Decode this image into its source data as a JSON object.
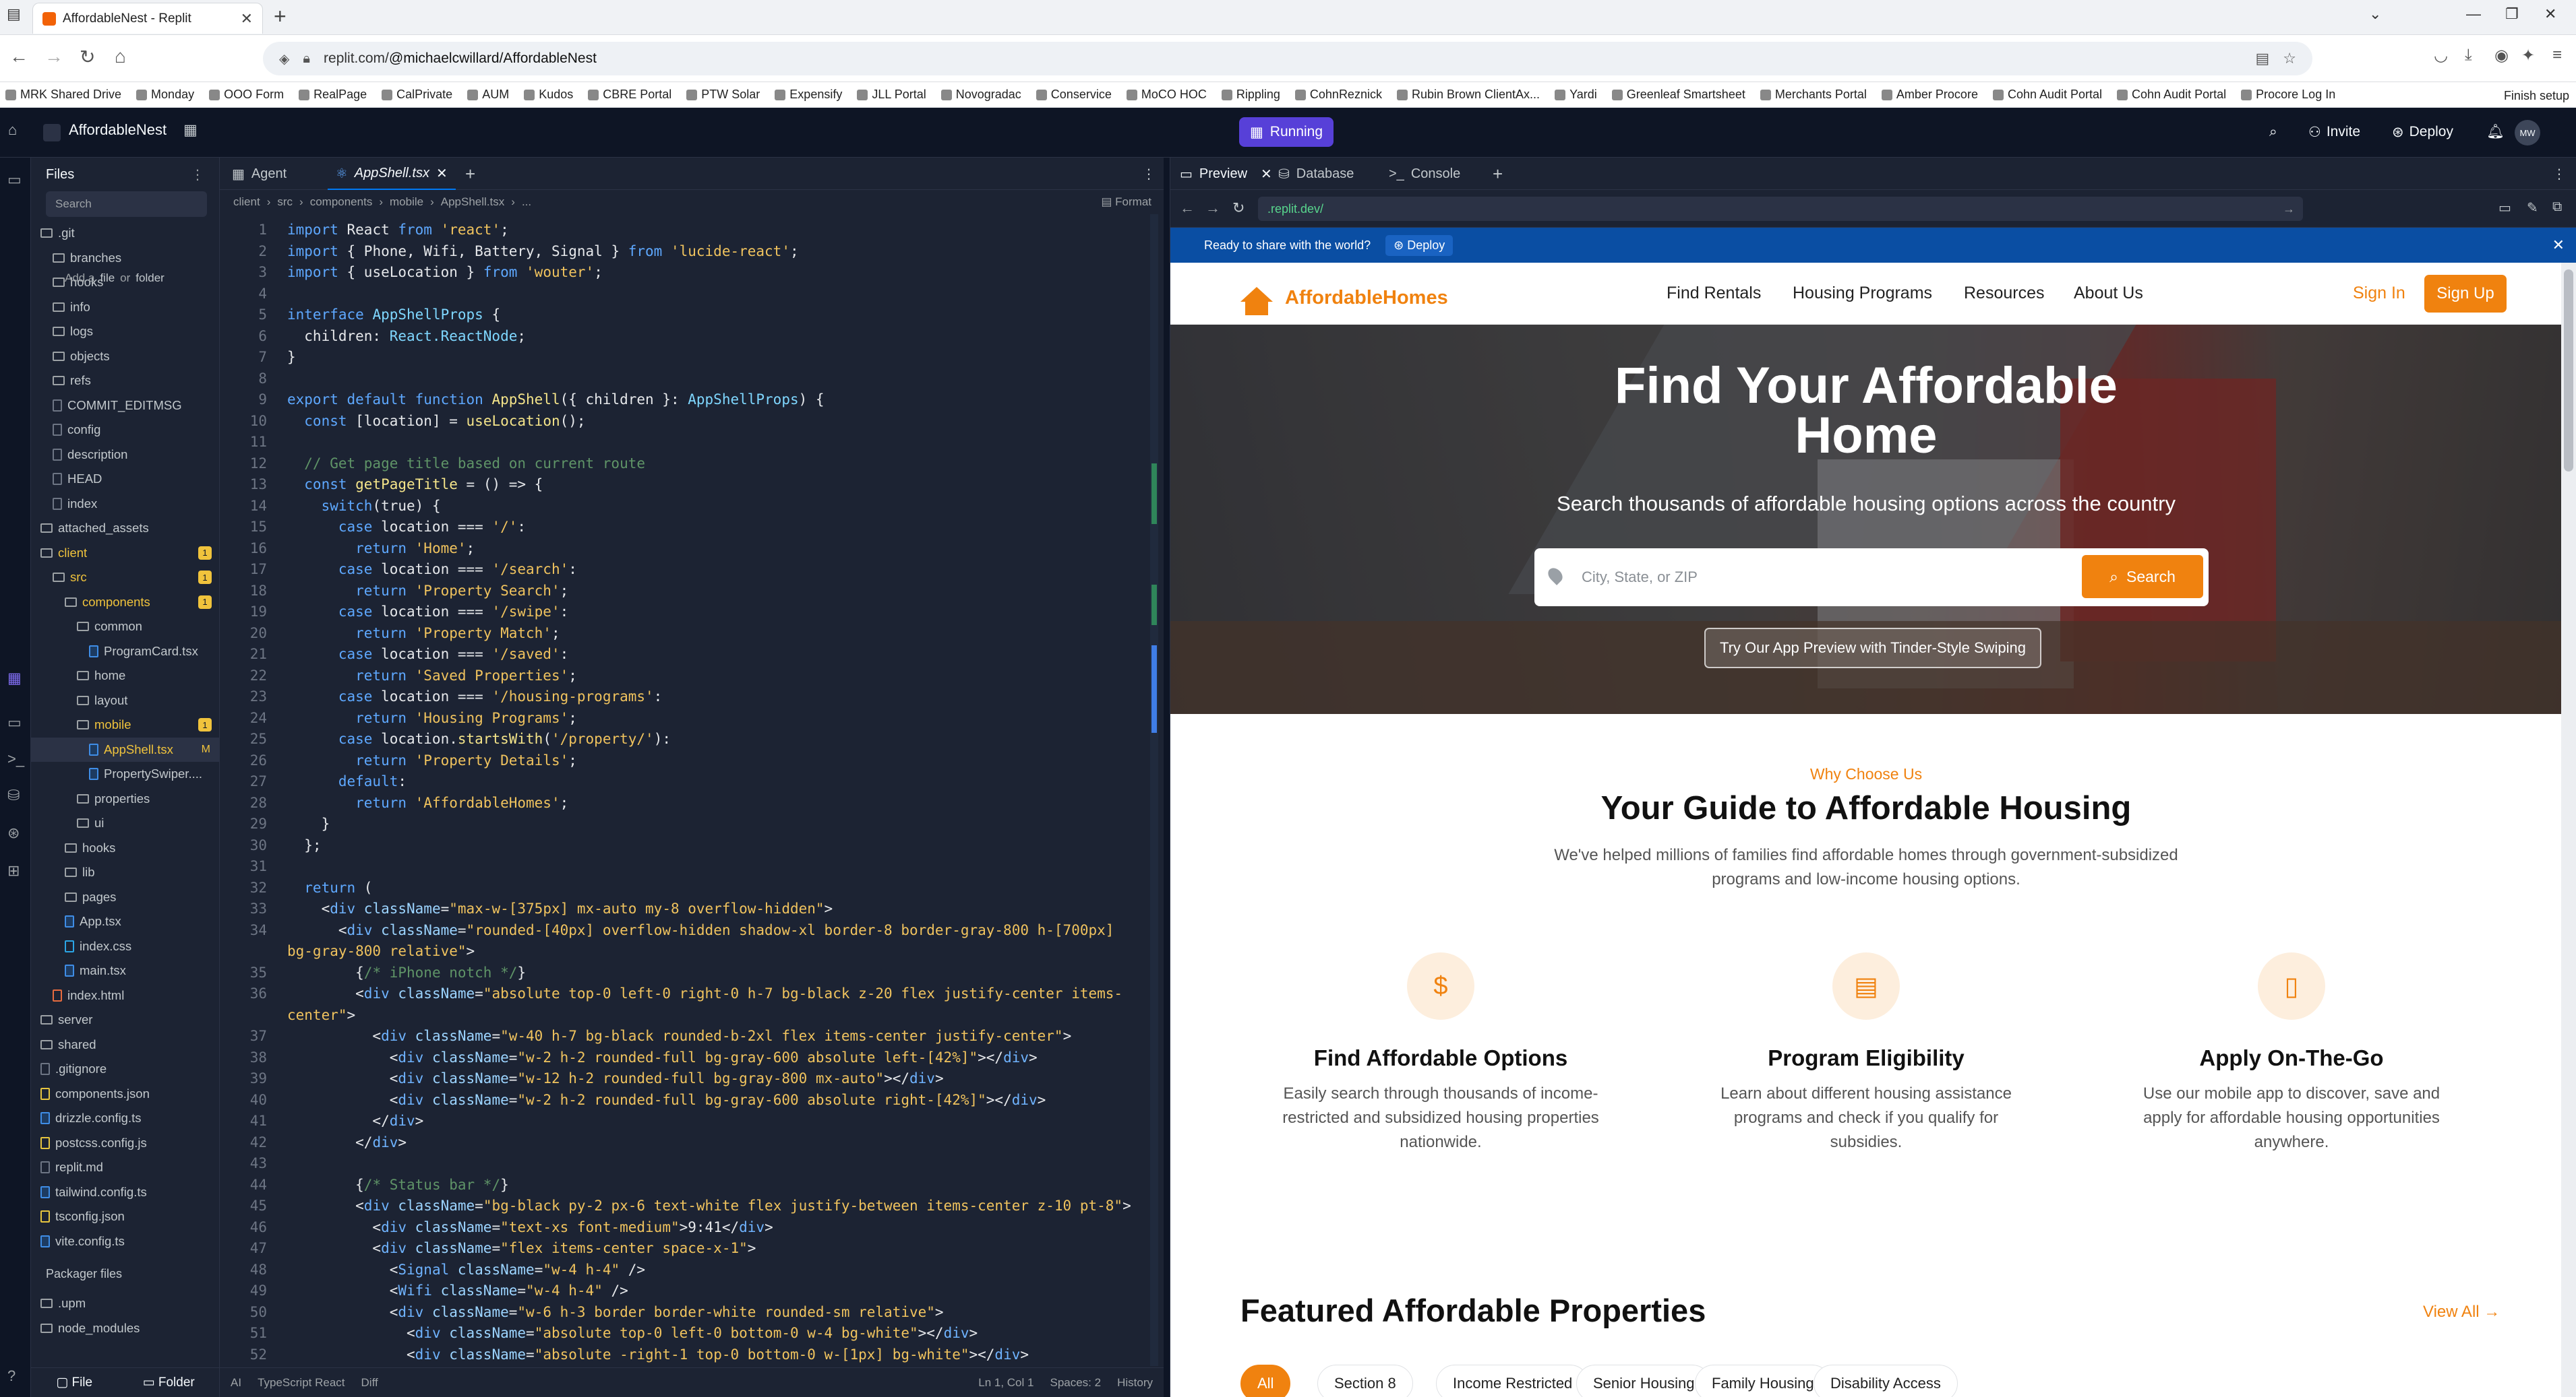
{
  "browser": {
    "tab_title": "AffordableNest - Replit",
    "url_prefix": "replit.com/",
    "url_path": "@michaelcwillard/AffordableNest",
    "bookmarks": [
      "MRK Shared Drive",
      "Monday",
      "OOO Form",
      "RealPage",
      "CalPrivate",
      "AUM",
      "Kudos",
      "CBRE Portal",
      "PTW Solar",
      "Expensify",
      "JLL Portal",
      "Novogradac",
      "Conservice",
      "MoCO HOC",
      "Rippling",
      "CohnReznick",
      "Rubin Brown ClientAx...",
      "Yardi",
      "Greenleaf Smartsheet",
      "Merchants Portal",
      "Amber Procore",
      "Cohn Audit Portal",
      "Cohn Audit Portal",
      "Procore Log In"
    ],
    "finish_setup": "Finish setup"
  },
  "replit": {
    "project": "AffordableNest",
    "run_label": "Running",
    "invite": "Invite",
    "deploy": "Deploy",
    "avatar": "MW"
  },
  "files": {
    "title": "Files",
    "search_placeholder": "Search",
    "add_hint": [
      "Add a",
      "file",
      "or",
      "folder"
    ],
    "rows": [
      {
        "label": ".git",
        "depth": 0,
        "kind": "dir"
      },
      {
        "label": "branches",
        "depth": 1,
        "kind": "dir"
      },
      {
        "label": "hooks",
        "depth": 1,
        "kind": "dir"
      },
      {
        "label": "info",
        "depth": 1,
        "kind": "dir"
      },
      {
        "label": "logs",
        "depth": 1,
        "kind": "dir"
      },
      {
        "label": "objects",
        "depth": 1,
        "kind": "dir"
      },
      {
        "label": "refs",
        "depth": 1,
        "kind": "dir"
      },
      {
        "label": "COMMIT_EDITMSG",
        "depth": 1,
        "kind": "file"
      },
      {
        "label": "config",
        "depth": 1,
        "kind": "file"
      },
      {
        "label": "description",
        "depth": 1,
        "kind": "file"
      },
      {
        "label": "HEAD",
        "depth": 1,
        "kind": "file"
      },
      {
        "label": "index",
        "depth": 1,
        "kind": "file"
      },
      {
        "label": "attached_assets",
        "depth": 0,
        "kind": "dir"
      },
      {
        "label": "client",
        "depth": 0,
        "kind": "dir",
        "badge": "1",
        "mod": true
      },
      {
        "label": "src",
        "depth": 1,
        "kind": "dir",
        "badge": "1",
        "mod": true
      },
      {
        "label": "components",
        "depth": 2,
        "kind": "dir",
        "badge": "1",
        "mod": true
      },
      {
        "label": "common",
        "depth": 3,
        "kind": "dir"
      },
      {
        "label": "ProgramCard.tsx",
        "depth": 4,
        "kind": "ts"
      },
      {
        "label": "home",
        "depth": 3,
        "kind": "dir"
      },
      {
        "label": "layout",
        "depth": 3,
        "kind": "dir"
      },
      {
        "label": "mobile",
        "depth": 3,
        "kind": "dir",
        "badge": "1",
        "mod": true
      },
      {
        "label": "AppShell.tsx",
        "depth": 4,
        "kind": "ts",
        "sel": true,
        "mod": true,
        "flag": "M"
      },
      {
        "label": "PropertySwiper....",
        "depth": 4,
        "kind": "ts"
      },
      {
        "label": "properties",
        "depth": 3,
        "kind": "dir"
      },
      {
        "label": "ui",
        "depth": 3,
        "kind": "dir"
      },
      {
        "label": "hooks",
        "depth": 2,
        "kind": "dir"
      },
      {
        "label": "lib",
        "depth": 2,
        "kind": "dir"
      },
      {
        "label": "pages",
        "depth": 2,
        "kind": "dir"
      },
      {
        "label": "App.tsx",
        "depth": 2,
        "kind": "ts"
      },
      {
        "label": "index.css",
        "depth": 2,
        "kind": "cs"
      },
      {
        "label": "main.tsx",
        "depth": 2,
        "kind": "ts"
      },
      {
        "label": "index.html",
        "depth": 1,
        "kind": "h"
      },
      {
        "label": "server",
        "depth": 0,
        "kind": "dir"
      },
      {
        "label": "shared",
        "depth": 0,
        "kind": "dir"
      },
      {
        "label": ".gitignore",
        "depth": 0,
        "kind": "file"
      },
      {
        "label": "components.json",
        "depth": 0,
        "kind": "js"
      },
      {
        "label": "drizzle.config.ts",
        "depth": 0,
        "kind": "ts"
      },
      {
        "label": "postcss.config.js",
        "depth": 0,
        "kind": "js"
      },
      {
        "label": "replit.md",
        "depth": 0,
        "kind": "file"
      },
      {
        "label": "tailwind.config.ts",
        "depth": 0,
        "kind": "ts"
      },
      {
        "label": "tsconfig.json",
        "depth": 0,
        "kind": "js"
      },
      {
        "label": "vite.config.ts",
        "depth": 0,
        "kind": "ts"
      }
    ],
    "packager_title": "Packager files",
    "packager_rows": [
      ".upm",
      "node_modules"
    ],
    "new_file": "File",
    "new_folder": "Folder"
  },
  "editor": {
    "tab_agent": "Agent",
    "tab_file": "AppShell.tsx",
    "breadcrumb": [
      "client",
      "src",
      "components",
      "mobile",
      "AppShell.tsx",
      "..."
    ],
    "format": "Format",
    "status": {
      "ai": "AI",
      "lang": "TypeScript React",
      "diff": "Diff",
      "pos": "Ln 1, Col 1",
      "spaces": "Spaces: 2",
      "history": "History"
    }
  },
  "code_lines": [
    [
      [
        "k",
        "import "
      ],
      [
        "p",
        "React "
      ],
      [
        "k",
        "from "
      ],
      [
        "s",
        "'react'"
      ],
      [
        "p",
        ";"
      ]
    ],
    [
      [
        "k",
        "import "
      ],
      [
        "p",
        "{ Phone, Wifi, Battery, Signal } "
      ],
      [
        "k",
        "from "
      ],
      [
        "s",
        "'lucide-react'"
      ],
      [
        "p",
        ";"
      ]
    ],
    [
      [
        "k",
        "import "
      ],
      [
        "p",
        "{ useLocation } "
      ],
      [
        "k",
        "from "
      ],
      [
        "s",
        "'wouter'"
      ],
      [
        "p",
        ";"
      ]
    ],
    [],
    [
      [
        "k",
        "interface "
      ],
      [
        "t",
        "AppShellProps "
      ],
      [
        "p",
        "{"
      ]
    ],
    [
      [
        "p",
        "  children: "
      ],
      [
        "t",
        "React.ReactNode"
      ],
      [
        "p",
        ";"
      ]
    ],
    [
      [
        "p",
        "}"
      ]
    ],
    [],
    [
      [
        "k",
        "export default function "
      ],
      [
        "fn",
        "AppShell"
      ],
      [
        "p",
        "({ children }: "
      ],
      [
        "t",
        "AppShellProps"
      ],
      [
        "p",
        ") {"
      ]
    ],
    [
      [
        "k",
        "  const "
      ],
      [
        "p",
        "[location] = "
      ],
      [
        "fn",
        "useLocation"
      ],
      [
        "p",
        "();"
      ]
    ],
    [],
    [
      [
        "c",
        "  // Get page title based on current route"
      ]
    ],
    [
      [
        "k",
        "  const "
      ],
      [
        "fn",
        "getPageTitle "
      ],
      [
        "p",
        "= () => {"
      ]
    ],
    [
      [
        "k",
        "    switch"
      ],
      [
        "p",
        "(true) {"
      ]
    ],
    [
      [
        "k",
        "      case "
      ],
      [
        "p",
        "location === "
      ],
      [
        "s",
        "'/'"
      ],
      [
        "p",
        ":"
      ]
    ],
    [
      [
        "k",
        "        return "
      ],
      [
        "s",
        "'Home'"
      ],
      [
        "p",
        ";"
      ]
    ],
    [
      [
        "k",
        "      case "
      ],
      [
        "p",
        "location === "
      ],
      [
        "s",
        "'/search'"
      ],
      [
        "p",
        ":"
      ]
    ],
    [
      [
        "k",
        "        return "
      ],
      [
        "s",
        "'Property Search'"
      ],
      [
        "p",
        ";"
      ]
    ],
    [
      [
        "k",
        "      case "
      ],
      [
        "p",
        "location === "
      ],
      [
        "s",
        "'/swipe'"
      ],
      [
        "p",
        ":"
      ]
    ],
    [
      [
        "k",
        "        return "
      ],
      [
        "s",
        "'Property Match'"
      ],
      [
        "p",
        ";"
      ]
    ],
    [
      [
        "k",
        "      case "
      ],
      [
        "p",
        "location === "
      ],
      [
        "s",
        "'/saved'"
      ],
      [
        "p",
        ":"
      ]
    ],
    [
      [
        "k",
        "        return "
      ],
      [
        "s",
        "'Saved Properties'"
      ],
      [
        "p",
        ";"
      ]
    ],
    [
      [
        "k",
        "      case "
      ],
      [
        "p",
        "location === "
      ],
      [
        "s",
        "'/housing-programs'"
      ],
      [
        "p",
        ":"
      ]
    ],
    [
      [
        "k",
        "        return "
      ],
      [
        "s",
        "'Housing Programs'"
      ],
      [
        "p",
        ";"
      ]
    ],
    [
      [
        "k",
        "      case "
      ],
      [
        "p",
        "location."
      ],
      [
        "fn",
        "startsWith"
      ],
      [
        "p",
        "("
      ],
      [
        "s",
        "'/property/'"
      ],
      [
        "p",
        "):"
      ]
    ],
    [
      [
        "k",
        "        return "
      ],
      [
        "s",
        "'Property Details'"
      ],
      [
        "p",
        ";"
      ]
    ],
    [
      [
        "k",
        "      default"
      ],
      [
        "p",
        ":"
      ]
    ],
    [
      [
        "k",
        "        return "
      ],
      [
        "s",
        "'AffordableHomes'"
      ],
      [
        "p",
        ";"
      ]
    ],
    [
      [
        "p",
        "    }"
      ]
    ],
    [
      [
        "p",
        "  };"
      ]
    ],
    [],
    [
      [
        "k",
        "  return "
      ],
      [
        "p",
        "("
      ]
    ],
    [
      [
        "p",
        "    <"
      ],
      [
        "tg",
        "div "
      ],
      [
        "at",
        "className"
      ],
      [
        "p",
        "="
      ],
      [
        "s",
        "\"max-w-[375px] mx-auto my-8 overflow-hidden\""
      ],
      [
        "p",
        ">"
      ]
    ],
    [
      [
        "p",
        "      <"
      ],
      [
        "tg",
        "div "
      ],
      [
        "at",
        "className"
      ],
      [
        "p",
        "="
      ],
      [
        "s",
        "\"rounded-[40px] overflow-hidden shadow-xl border-8 border-gray-800 h-[700px]"
      ]
    ],
    [
      [
        "s",
        "bg-gray-800 relative\""
      ],
      [
        "p",
        ">"
      ]
    ],
    [
      [
        "p",
        "        {"
      ],
      [
        "c",
        "/* iPhone notch */"
      ],
      [
        "p",
        "}"
      ]
    ],
    [
      [
        "p",
        "        <"
      ],
      [
        "tg",
        "div "
      ],
      [
        "at",
        "className"
      ],
      [
        "p",
        "="
      ],
      [
        "s",
        "\"absolute top-0 left-0 right-0 h-7 bg-black z-20 flex justify-center items-"
      ]
    ],
    [
      [
        "s",
        "center\""
      ],
      [
        "p",
        ">"
      ]
    ],
    [
      [
        "p",
        "          <"
      ],
      [
        "tg",
        "div "
      ],
      [
        "at",
        "className"
      ],
      [
        "p",
        "="
      ],
      [
        "s",
        "\"w-40 h-7 bg-black rounded-b-2xl flex items-center justify-center\""
      ],
      [
        "p",
        ">"
      ]
    ],
    [
      [
        "p",
        "            <"
      ],
      [
        "tg",
        "div "
      ],
      [
        "at",
        "className"
      ],
      [
        "p",
        "="
      ],
      [
        "s",
        "\"w-2 h-2 rounded-full bg-gray-600 absolute left-[42%]\""
      ],
      [
        "p",
        "></"
      ],
      [
        "tg",
        "div"
      ],
      [
        "p",
        ">"
      ]
    ],
    [
      [
        "p",
        "            <"
      ],
      [
        "tg",
        "div "
      ],
      [
        "at",
        "className"
      ],
      [
        "p",
        "="
      ],
      [
        "s",
        "\"w-12 h-2 rounded-full bg-gray-800 mx-auto\""
      ],
      [
        "p",
        "></"
      ],
      [
        "tg",
        "div"
      ],
      [
        "p",
        ">"
      ]
    ],
    [
      [
        "p",
        "            <"
      ],
      [
        "tg",
        "div "
      ],
      [
        "at",
        "className"
      ],
      [
        "p",
        "="
      ],
      [
        "s",
        "\"w-2 h-2 rounded-full bg-gray-600 absolute right-[42%]\""
      ],
      [
        "p",
        "></"
      ],
      [
        "tg",
        "div"
      ],
      [
        "p",
        ">"
      ]
    ],
    [
      [
        "p",
        "          </"
      ],
      [
        "tg",
        "div"
      ],
      [
        "p",
        ">"
      ]
    ],
    [
      [
        "p",
        "        </"
      ],
      [
        "tg",
        "div"
      ],
      [
        "p",
        ">"
      ]
    ],
    [],
    [
      [
        "p",
        "        {"
      ],
      [
        "c",
        "/* Status bar */"
      ],
      [
        "p",
        "}"
      ]
    ],
    [
      [
        "p",
        "        <"
      ],
      [
        "tg",
        "div "
      ],
      [
        "at",
        "className"
      ],
      [
        "p",
        "="
      ],
      [
        "s",
        "\"bg-black py-2 px-6 text-white flex justify-between items-center z-10 pt-8\""
      ],
      [
        "p",
        ">"
      ]
    ],
    [
      [
        "p",
        "          <"
      ],
      [
        "tg",
        "div "
      ],
      [
        "at",
        "className"
      ],
      [
        "p",
        "="
      ],
      [
        "s",
        "\"text-xs font-medium\""
      ],
      [
        "p",
        ">9:41</"
      ],
      [
        "tg",
        "div"
      ],
      [
        "p",
        ">"
      ]
    ],
    [
      [
        "p",
        "          <"
      ],
      [
        "tg",
        "div "
      ],
      [
        "at",
        "className"
      ],
      [
        "p",
        "="
      ],
      [
        "s",
        "\"flex items-center space-x-1\""
      ],
      [
        "p",
        ">"
      ]
    ],
    [
      [
        "p",
        "            <"
      ],
      [
        "tg",
        "Signal "
      ],
      [
        "at",
        "className"
      ],
      [
        "p",
        "="
      ],
      [
        "s",
        "\"w-4 h-4\" "
      ],
      [
        "p",
        "/>"
      ]
    ],
    [
      [
        "p",
        "            <"
      ],
      [
        "tg",
        "Wifi "
      ],
      [
        "at",
        "className"
      ],
      [
        "p",
        "="
      ],
      [
        "s",
        "\"w-4 h-4\" "
      ],
      [
        "p",
        "/>"
      ]
    ],
    [
      [
        "p",
        "            <"
      ],
      [
        "tg",
        "div "
      ],
      [
        "at",
        "className"
      ],
      [
        "p",
        "="
      ],
      [
        "s",
        "\"w-6 h-3 border border-white rounded-sm relative\""
      ],
      [
        "p",
        ">"
      ]
    ],
    [
      [
        "p",
        "              <"
      ],
      [
        "tg",
        "div "
      ],
      [
        "at",
        "className"
      ],
      [
        "p",
        "="
      ],
      [
        "s",
        "\"absolute top-0 left-0 bottom-0 w-4 bg-white\""
      ],
      [
        "p",
        "></"
      ],
      [
        "tg",
        "div"
      ],
      [
        "p",
        ">"
      ]
    ],
    [
      [
        "p",
        "              <"
      ],
      [
        "tg",
        "div "
      ],
      [
        "at",
        "className"
      ],
      [
        "p",
        "="
      ],
      [
        "s",
        "\"absolute -right-1 top-0 bottom-0 w-[1px] bg-white\""
      ],
      [
        "p",
        "></"
      ],
      [
        "tg",
        "div"
      ],
      [
        "p",
        ">"
      ]
    ]
  ],
  "line_numbers": [
    "1",
    "2",
    "3",
    "4",
    "5",
    "6",
    "7",
    "8",
    "9",
    "10",
    "11",
    "12",
    "13",
    "14",
    "15",
    "16",
    "17",
    "18",
    "19",
    "20",
    "21",
    "22",
    "23",
    "24",
    "25",
    "26",
    "27",
    "28",
    "29",
    "30",
    "31",
    "32",
    "33",
    "34",
    "",
    "35",
    "36",
    "",
    "37",
    "38",
    "39",
    "40",
    "41",
    "42",
    "43",
    "44",
    "45",
    "46",
    "47",
    "48",
    "49",
    "50",
    "51",
    "52"
  ],
  "preview": {
    "tab_preview": "Preview",
    "tab_database": "Database",
    "tab_console": "Console",
    "url": ".replit.dev/",
    "banner_text": "Ready to share with the world?",
    "banner_deploy": "Deploy"
  },
  "site": {
    "brand": "AffordableHomes",
    "nav": [
      "Find Rentals",
      "Housing Programs",
      "Resources",
      "About Us"
    ],
    "sign_in": "Sign In",
    "sign_up": "Sign Up",
    "hero_title_1": "Find Your Affordable",
    "hero_title_2": "Home",
    "hero_sub": "Search thousands of affordable housing options across the country",
    "search_placeholder": "City, State, or ZIP",
    "search_btn": "Search",
    "app_btn": "Try Our App Preview with Tinder-Style Swiping",
    "why": "Why Choose Us",
    "guide_title": "Your Guide to Affordable Housing",
    "guide_desc": "We've helped millions of families find affordable homes through government-subsidized programs and low-income housing options.",
    "features": [
      {
        "icon": "dollar-search-icon",
        "glyph": "$",
        "title": "Find Affordable Options",
        "desc": "Easily search through thousands of income-restricted and subsidized housing properties nationwide."
      },
      {
        "icon": "document-icon",
        "glyph": "▤",
        "title": "Program Eligibility",
        "desc": "Learn about different housing assistance programs and check if you qualify for subsidies."
      },
      {
        "icon": "mobile-icon",
        "glyph": "▯",
        "title": "Apply On-The-Go",
        "desc": "Use our mobile app to discover, save and apply for affordable housing opportunities anywhere."
      }
    ],
    "featured_title": "Featured Affordable Properties",
    "view_all": "View All →",
    "filters": [
      "All",
      "Section 8",
      "Income Restricted",
      "Senior Housing",
      "Family Housing",
      "Disability Access"
    ]
  },
  "colors": {
    "accent": "#f0820f",
    "replit_bg": "#0e1525",
    "panel": "#1c2333",
    "run": "#5740d8",
    "banner": "#0a4ea3"
  }
}
